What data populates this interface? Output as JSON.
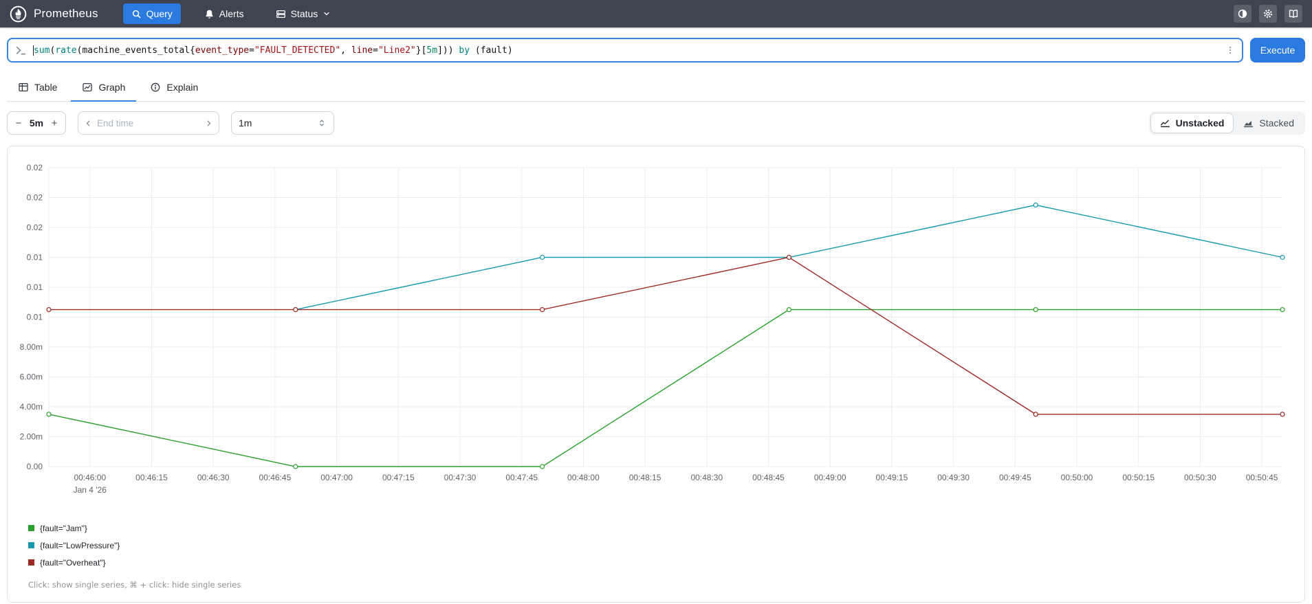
{
  "navbar": {
    "brand": "Prometheus",
    "items": [
      {
        "label": "Query",
        "icon": "search-icon",
        "active": true
      },
      {
        "label": "Alerts",
        "icon": "bell-icon",
        "active": false
      },
      {
        "label": "Status",
        "icon": "server-icon",
        "active": false,
        "has_chevron": true
      }
    ],
    "action_icons": [
      "contrast-icon",
      "gear-icon",
      "book-icon"
    ],
    "colors": {
      "background": "#3e4450",
      "active_item": "#2a7ae0"
    }
  },
  "query_bar": {
    "expression_plain": "sum(rate(machine_events_total{event_type=\"FAULT_DETECTED\", line=\"Line2\"}[5m])) by (fault)",
    "tokens": [
      {
        "text": "sum",
        "color": "keyword"
      },
      {
        "text": "(",
        "color": "plain"
      },
      {
        "text": "rate",
        "color": "keyword"
      },
      {
        "text": "(",
        "color": "plain"
      },
      {
        "text": "machine_events_total",
        "color": "plain"
      },
      {
        "text": "{",
        "color": "plain"
      },
      {
        "text": "event_type",
        "color": "label"
      },
      {
        "text": "=",
        "color": "plain"
      },
      {
        "text": "\"FAULT_DETECTED\"",
        "color": "string"
      },
      {
        "text": ", ",
        "color": "plain"
      },
      {
        "text": "line",
        "color": "label"
      },
      {
        "text": "=",
        "color": "plain"
      },
      {
        "text": "\"Line2\"",
        "color": "string"
      },
      {
        "text": "}",
        "color": "plain"
      },
      {
        "text": "[",
        "color": "plain"
      },
      {
        "text": "5m",
        "color": "duration"
      },
      {
        "text": "]",
        "color": "plain"
      },
      {
        "text": "))",
        "color": "plain"
      },
      {
        "text": " ",
        "color": "plain"
      },
      {
        "text": "by",
        "color": "keyword"
      },
      {
        "text": " (fault)",
        "color": "plain"
      }
    ],
    "syntax_colors": {
      "keyword": "#008080",
      "label": "#800000",
      "string": "#a31515",
      "duration": "#09885a",
      "plain": "#111111"
    },
    "execute_label": "Execute"
  },
  "tabs": [
    {
      "label": "Table",
      "icon": "table-icon",
      "active": false
    },
    {
      "label": "Graph",
      "icon": "graph-icon",
      "active": true
    },
    {
      "label": "Explain",
      "icon": "info-icon",
      "active": false
    }
  ],
  "controls": {
    "range": {
      "decrease_label": "−",
      "value": "5m",
      "increase_label": "+"
    },
    "end_time": {
      "placeholder": "End time"
    },
    "resolution": {
      "value": "1m"
    },
    "stacking": [
      {
        "label": "Unstacked",
        "icon": "line-chart-icon",
        "active": true
      },
      {
        "label": "Stacked",
        "icon": "area-chart-icon",
        "active": false
      }
    ]
  },
  "chart_data": {
    "type": "line",
    "title": "",
    "xlabel": "",
    "ylabel": "",
    "x_is_time": true,
    "x_domain_seconds": [
      0,
      300
    ],
    "x_start_time": "00:45:50",
    "x_points_seconds": [
      0,
      60,
      120,
      180,
      240,
      300
    ],
    "x_ticks": [
      {
        "s": 10,
        "label": "00:46:00",
        "sublabel": "Jan 4 '26"
      },
      {
        "s": 25,
        "label": "00:46:15"
      },
      {
        "s": 40,
        "label": "00:46:30"
      },
      {
        "s": 55,
        "label": "00:46:45"
      },
      {
        "s": 70,
        "label": "00:47:00"
      },
      {
        "s": 85,
        "label": "00:47:15"
      },
      {
        "s": 100,
        "label": "00:47:30"
      },
      {
        "s": 115,
        "label": "00:47:45"
      },
      {
        "s": 130,
        "label": "00:48:00"
      },
      {
        "s": 145,
        "label": "00:48:15"
      },
      {
        "s": 160,
        "label": "00:48:30"
      },
      {
        "s": 175,
        "label": "00:48:45"
      },
      {
        "s": 190,
        "label": "00:49:00"
      },
      {
        "s": 205,
        "label": "00:49:15"
      },
      {
        "s": 220,
        "label": "00:49:30"
      },
      {
        "s": 235,
        "label": "00:49:45"
      },
      {
        "s": 250,
        "label": "00:50:00"
      },
      {
        "s": 265,
        "label": "00:50:15"
      },
      {
        "s": 280,
        "label": "00:50:30"
      },
      {
        "s": 295,
        "label": "00:50:45"
      }
    ],
    "ylim": [
      0,
      0.02
    ],
    "y_ticks": [
      {
        "v": 0.02,
        "label": "0.02"
      },
      {
        "v": 0.018,
        "label": "0.02"
      },
      {
        "v": 0.016,
        "label": "0.02"
      },
      {
        "v": 0.014,
        "label": "0.01"
      },
      {
        "v": 0.012,
        "label": "0.01"
      },
      {
        "v": 0.01,
        "label": "0.01"
      },
      {
        "v": 0.008,
        "label": "8.00m"
      },
      {
        "v": 0.006,
        "label": "6.00m"
      },
      {
        "v": 0.004,
        "label": "4.00m"
      },
      {
        "v": 0.002,
        "label": "2.00m"
      },
      {
        "v": 0.0,
        "label": "0.00"
      }
    ],
    "grid": true,
    "legend_position": "bottom-left",
    "series": [
      {
        "name": "{fault=\"Jam\"}",
        "color": "#2ca02c",
        "values": [
          0.0035,
          0,
          0,
          0.0105,
          0.0105,
          0.0105
        ]
      },
      {
        "name": "{fault=\"LowPressure\"}",
        "color": "#1899ac",
        "values": [
          null,
          0.0105,
          0.014,
          0.014,
          0.0175,
          0.014
        ]
      },
      {
        "name": "{fault=\"Overheat\"}",
        "color": "#9e2a25",
        "values": [
          0.0105,
          0.0105,
          0.0105,
          0.014,
          0.0035,
          0.0035
        ]
      }
    ],
    "legend_hint": "Click: show single series, ⌘ + click: hide single series"
  }
}
